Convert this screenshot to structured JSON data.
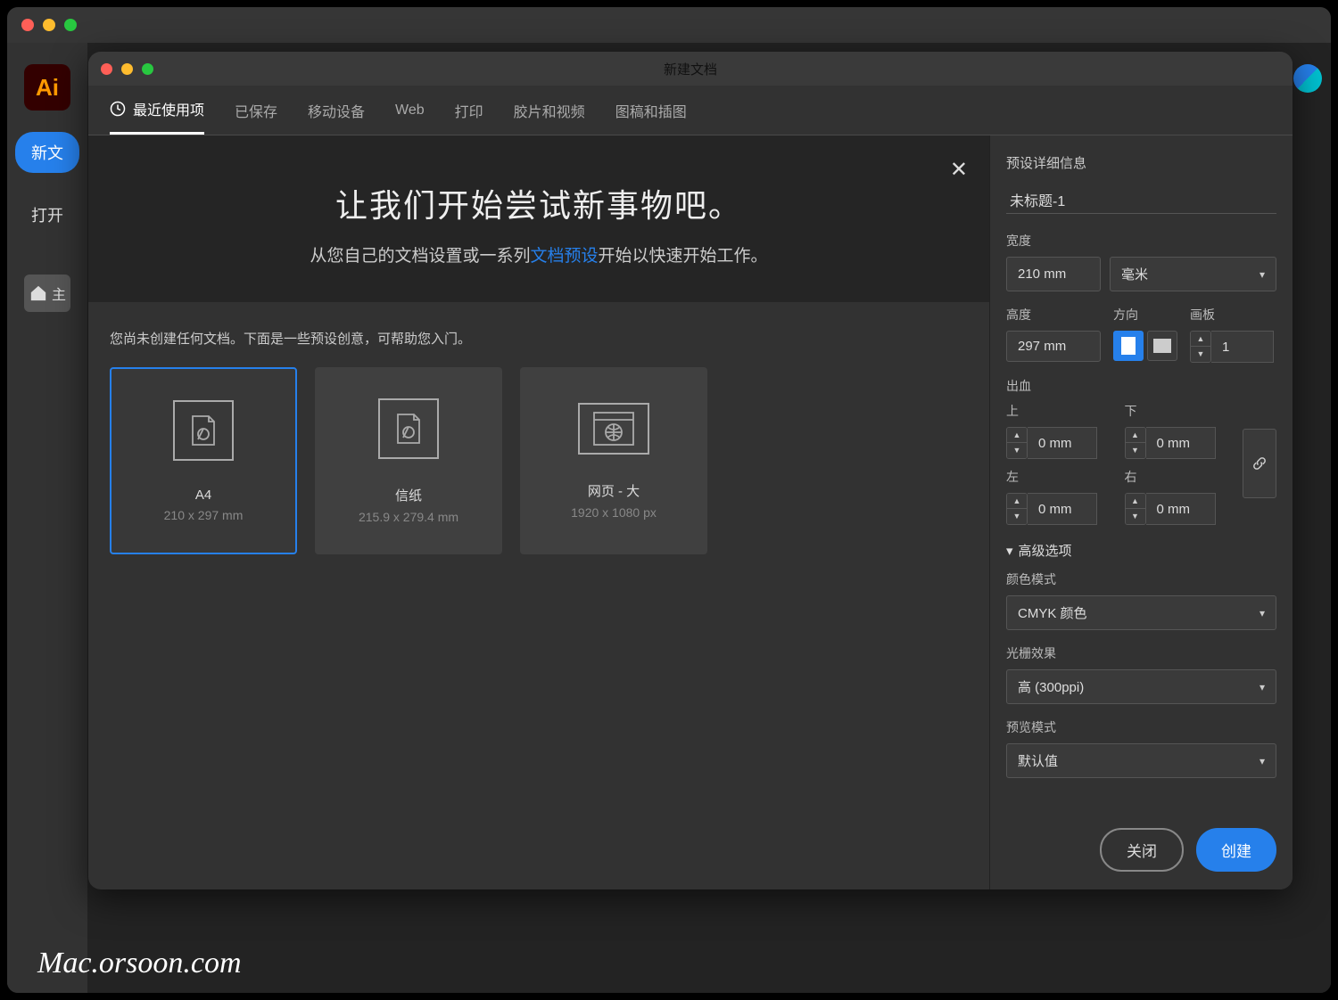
{
  "app": {
    "logo_text": "Ai",
    "sidebar": {
      "new_btn": "新文",
      "open_btn": "打开",
      "home_label": "主"
    }
  },
  "dialog": {
    "title": "新建文档",
    "tabs": [
      "最近使用项",
      "已保存",
      "移动设备",
      "Web",
      "打印",
      "胶片和视频",
      "图稿和插图"
    ],
    "hero": {
      "heading": "让我们开始尝试新事物吧。",
      "text_before": "从您自己的文档设置或一系列",
      "link_text": "文档预设",
      "text_after": "开始以快速开始工作。"
    },
    "presets_hint": "您尚未创建任何文档。下面是一些预设创意，可帮助您入门。",
    "presets": [
      {
        "name": "A4",
        "dims": "210 x 297 mm",
        "type": "doc"
      },
      {
        "name": "信纸",
        "dims": "215.9 x 279.4 mm",
        "type": "doc"
      },
      {
        "name": "网页 - 大",
        "dims": "1920 x 1080 px",
        "type": "web"
      }
    ]
  },
  "details": {
    "panel_title": "预设详细信息",
    "doc_name": "未标题-1",
    "width_label": "宽度",
    "width_value": "210 mm",
    "units": "毫米",
    "height_label": "高度",
    "height_value": "297 mm",
    "orientation_label": "方向",
    "artboards_label": "画板",
    "artboards_value": "1",
    "bleed_label": "出血",
    "bleed": {
      "top_label": "上",
      "bottom_label": "下",
      "left_label": "左",
      "right_label": "右",
      "value": "0 mm"
    },
    "advanced_label": "高级选项",
    "color_mode_label": "颜色模式",
    "color_mode_value": "CMYK 颜色",
    "raster_label": "光栅效果",
    "raster_value": "高 (300ppi)",
    "preview_label": "预览模式",
    "preview_value": "默认值"
  },
  "footer": {
    "close": "关闭",
    "create": "创建"
  },
  "watermark": "Mac.orsoon.com"
}
